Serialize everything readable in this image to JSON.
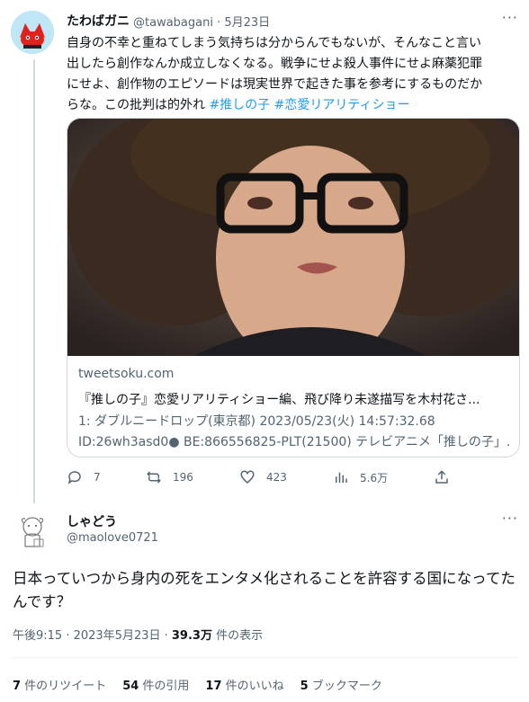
{
  "tweet1": {
    "name": "たわばガニ",
    "handle_date": "@tawabagani · 5月23日",
    "more": "···",
    "text_lines": [
      "自身の不幸と重ねてしまう気持ちは分からんでもないが、そんなこと言い",
      "出したら創作なんか成立しなくなる。戦争にせよ殺人事件にせよ麻薬犯罪",
      "にせよ、創作物のエピソードは現実世界で起きた事を参考にするものだか"
    ],
    "text_last": "らな。この批判は的外れ",
    "hashtags": [
      "#推しの子",
      "#恋愛リアリティショー"
    ],
    "card": {
      "domain": "tweetsoku.com",
      "title": "『推しの子』恋愛リアリティショー編、飛び降り未遂描写を木村花さ...",
      "desc_lines": [
        "1: ダブルニードロップ(東京都) 2023/05/23(火) 14:57:32.68",
        "ID:26wh3asd0● BE:866556825-PLT(21500) テレビアニメ「推しの子」..."
      ]
    },
    "actions": {
      "reply": "7",
      "retweet": "196",
      "like": "423",
      "views": "5.6万"
    }
  },
  "tweet2": {
    "name": "しゃどう",
    "handle": "@maolove0721",
    "more": "···",
    "text": "日本っていつから身内の死をエンタメ化されることを許容する国になってたんです？",
    "time": "午後9:15 · 2023年5月23日 · ",
    "views_count": "39.3万",
    "views_label": " 件の表示",
    "stats": [
      {
        "count": "7",
        "label": " 件のリツイート"
      },
      {
        "count": "54",
        "label": " 件の引用"
      },
      {
        "count": "17",
        "label": " 件のいいね"
      },
      {
        "count": "5",
        "label": " ブックマーク"
      }
    ]
  },
  "colors": {
    "link": "#1d9bf0",
    "secondary_text": "#536471",
    "border": "#cfd9de"
  }
}
